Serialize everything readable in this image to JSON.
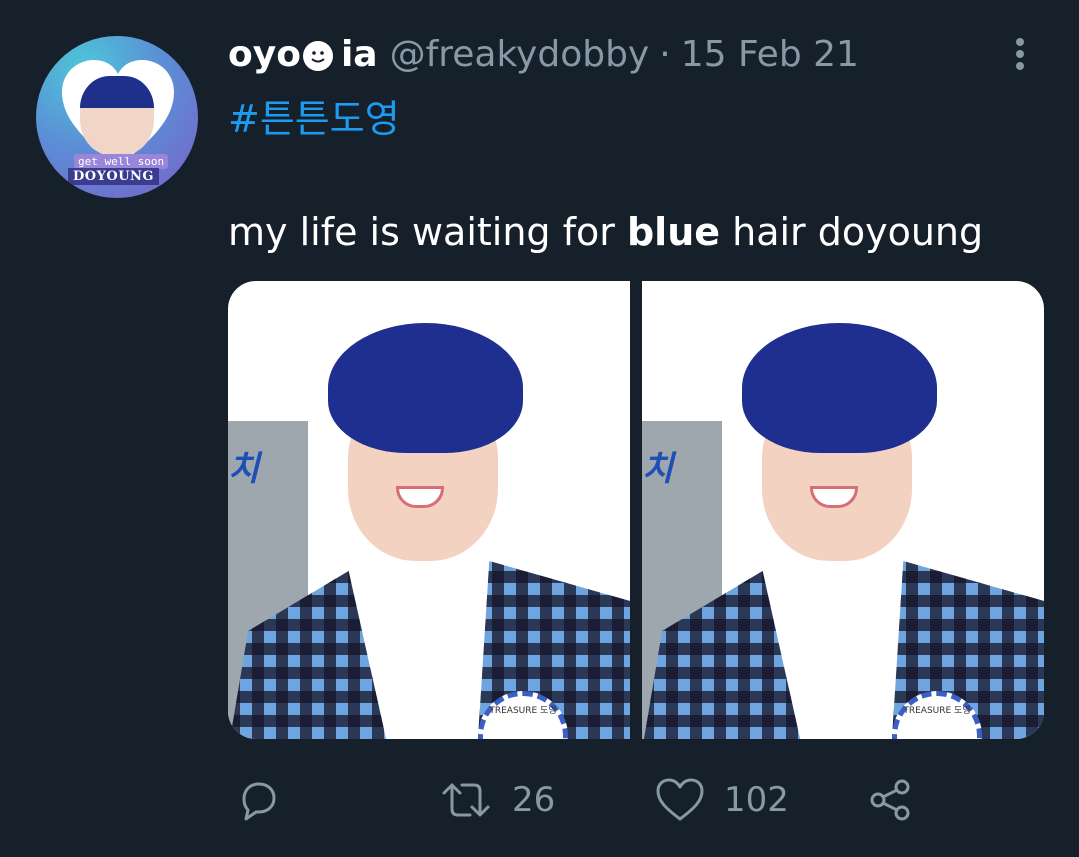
{
  "tweet": {
    "display_name_part1": "oyo",
    "display_name_part2": "ia",
    "handle": "@freakydobby",
    "separator": "·",
    "date": "15 Feb 21",
    "hashtag": "#튼튼도영",
    "text_before": "my life is waiting for ",
    "text_bold": "blue",
    "text_after": " hair doyoung"
  },
  "avatar": {
    "tag_small": "get well soon",
    "tag_big": "DOYOUNG"
  },
  "photos": [
    {
      "sticker_text": "치",
      "badge_text": "TREASURE 도영"
    },
    {
      "sticker_text": "치",
      "badge_text": "TREASURE 도영"
    }
  ],
  "actions": {
    "reply_icon": "reply-icon",
    "retweet_icon": "retweet-icon",
    "retweet_count": "26",
    "like_icon": "heart-icon",
    "like_count": "102",
    "share_icon": "share-icon"
  },
  "colors": {
    "background": "#15202b",
    "hashtag": "#1d9bf0",
    "muted": "#8899a6"
  }
}
